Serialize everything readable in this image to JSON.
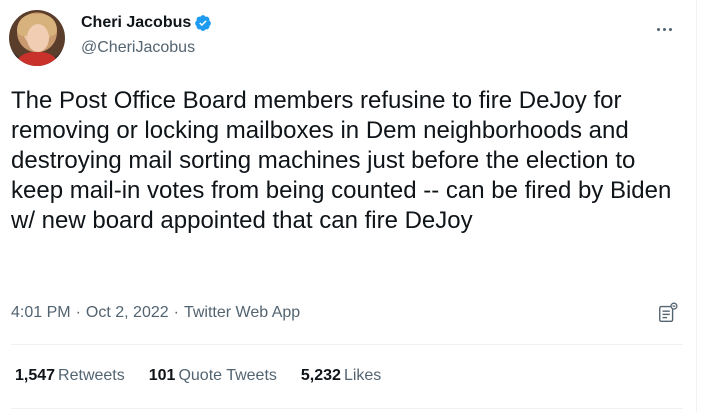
{
  "author": {
    "name": "Cheri Jacobus",
    "handle": "@CheriJacobus",
    "verified_color": "#1d9bf0"
  },
  "menu_icon": "more-horizontal-icon",
  "tweet": {
    "text": "The Post Office Board members refusine to fire DeJoy for removing or locking mailboxes in Dem neighborhoods and destroying mail sorting machines just before the election to keep mail-in votes from being counted -- can be fired by Biden w/ new board appointed that can fire DeJoy"
  },
  "meta": {
    "time": "4:01 PM",
    "separator": "·",
    "date": "Oct 2, 2022",
    "source": "Twitter Web App"
  },
  "stats": {
    "retweets_count": "1,547",
    "retweets_label": "Retweets",
    "quotes_count": "101",
    "quotes_label": "Quote Tweets",
    "likes_count": "5,232",
    "likes_label": "Likes"
  },
  "colors": {
    "text": "#0f1419",
    "secondary": "#536471",
    "divider": "#eff3f4"
  }
}
